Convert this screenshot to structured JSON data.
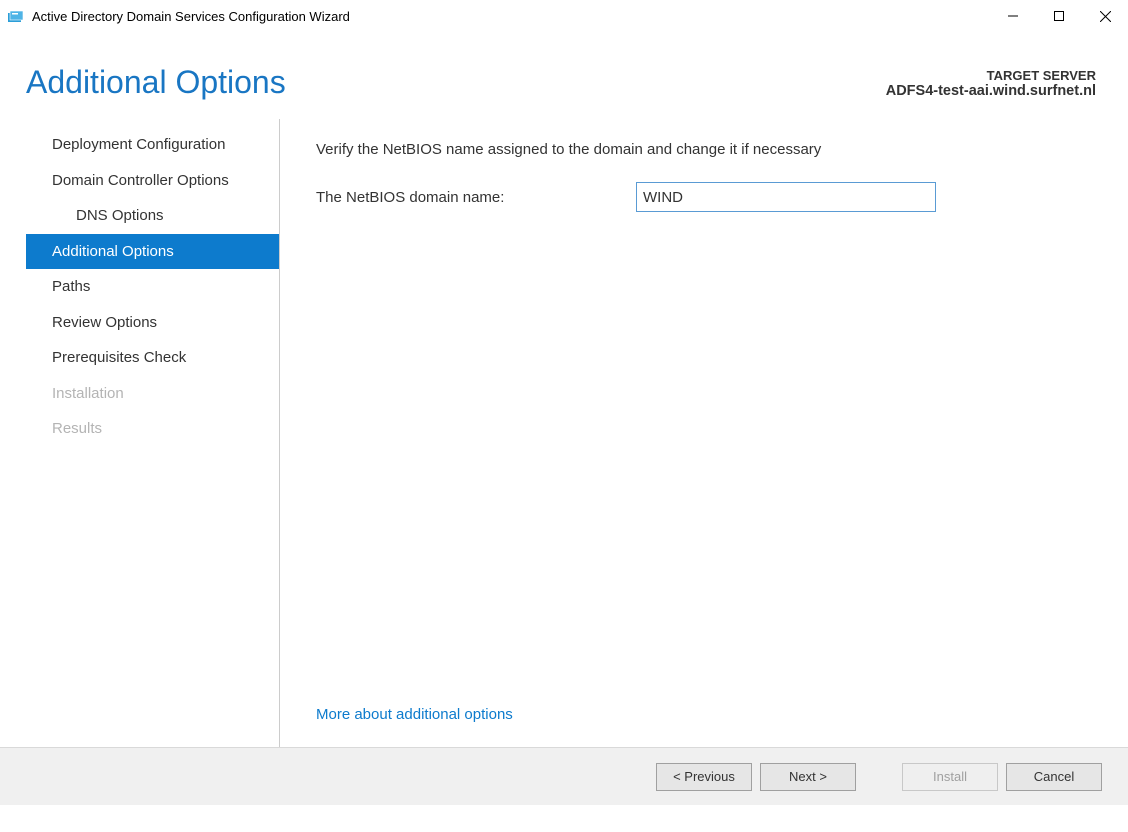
{
  "window": {
    "title": "Active Directory Domain Services Configuration Wizard"
  },
  "header": {
    "page_title": "Additional Options",
    "target_server_label": "TARGET SERVER",
    "target_server_value": "ADFS4-test-aai.wind.surfnet.nl"
  },
  "sidebar": {
    "items": [
      {
        "label": "Deployment Configuration",
        "sub": false,
        "selected": false,
        "disabled": false
      },
      {
        "label": "Domain Controller Options",
        "sub": false,
        "selected": false,
        "disabled": false
      },
      {
        "label": "DNS Options",
        "sub": true,
        "selected": false,
        "disabled": false
      },
      {
        "label": "Additional Options",
        "sub": false,
        "selected": true,
        "disabled": false
      },
      {
        "label": "Paths",
        "sub": false,
        "selected": false,
        "disabled": false
      },
      {
        "label": "Review Options",
        "sub": false,
        "selected": false,
        "disabled": false
      },
      {
        "label": "Prerequisites Check",
        "sub": false,
        "selected": false,
        "disabled": false
      },
      {
        "label": "Installation",
        "sub": false,
        "selected": false,
        "disabled": true
      },
      {
        "label": "Results",
        "sub": false,
        "selected": false,
        "disabled": true
      }
    ]
  },
  "content": {
    "instruction": "Verify the NetBIOS name assigned to the domain and change it if necessary",
    "field_label": "The NetBIOS domain name:",
    "field_value": "WIND",
    "more_link": "More about additional options"
  },
  "footer": {
    "previous": "< Previous",
    "next": "Next >",
    "install": "Install",
    "cancel": "Cancel"
  }
}
